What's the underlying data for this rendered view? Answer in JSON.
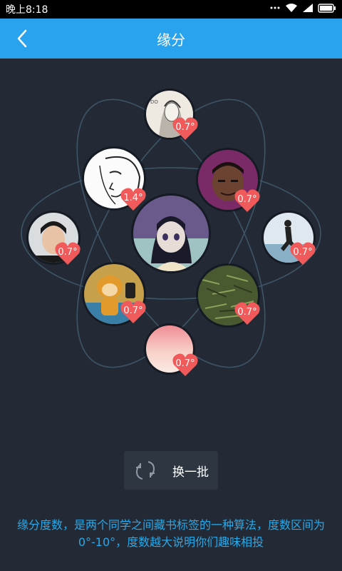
{
  "status": {
    "time": "晚上8:18"
  },
  "header": {
    "title": "缘分"
  },
  "center_user": {
    "name": "center"
  },
  "people": [
    {
      "degree": "0.7°"
    },
    {
      "degree": "1.4°"
    },
    {
      "degree": "0.7°"
    },
    {
      "degree": "0.7°"
    },
    {
      "degree": "0.7°"
    },
    {
      "degree": "0.7°"
    },
    {
      "degree": "0.7°"
    },
    {
      "degree": "0.7°"
    }
  ],
  "actions": {
    "refresh_label": "换一批"
  },
  "footer": {
    "description": "缘分度数，是两个同学之间藏书标签的一种算法，度数区间为0°-10°，度数越大说明你们趣味相投"
  },
  "colors": {
    "accent": "#2aa3ef",
    "background": "#232a35",
    "heart": "#f05a5a",
    "info_text": "#29a8e8"
  }
}
